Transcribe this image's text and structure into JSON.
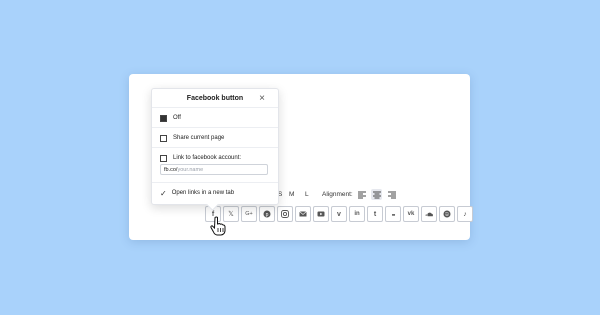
{
  "popup": {
    "title": "Facebook button",
    "close_icon": "×",
    "options": [
      {
        "label": "Off",
        "checked": true
      },
      {
        "label": "Share current page",
        "checked": false
      },
      {
        "label": "Link to facebook account:",
        "checked": false
      }
    ],
    "link_prefix": "fb.co/",
    "link_placeholder": "your.name",
    "open_new_tab_check": "✓",
    "open_new_tab_label": "Open links in a new tab"
  },
  "toolbar": {
    "sizes": [
      "S",
      "M",
      "L"
    ],
    "alignment_label": "Alignment:",
    "alignment_active": "center"
  },
  "social_icons": [
    {
      "name": "facebook-icon",
      "glyph": "f"
    },
    {
      "name": "x-icon",
      "glyph": "𝕏"
    },
    {
      "name": "google-plus-icon",
      "glyph": "G+"
    },
    {
      "name": "pinterest-icon",
      "glyph": ""
    },
    {
      "name": "instagram-icon",
      "glyph": ""
    },
    {
      "name": "email-icon",
      "glyph": ""
    },
    {
      "name": "youtube-icon",
      "glyph": ""
    },
    {
      "name": "vimeo-icon",
      "glyph": "v"
    },
    {
      "name": "linkedin-icon",
      "glyph": "in"
    },
    {
      "name": "tumblr-icon",
      "glyph": "t"
    },
    {
      "name": "flickr-icon",
      "glyph": "●●"
    },
    {
      "name": "vk-icon",
      "glyph": "vk"
    },
    {
      "name": "soundcloud-icon",
      "glyph": ""
    },
    {
      "name": "spotify-icon",
      "glyph": ""
    },
    {
      "name": "tiktok-icon",
      "glyph": "♪"
    }
  ]
}
